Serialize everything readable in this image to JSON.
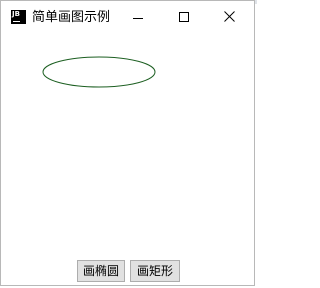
{
  "window": {
    "title": "简单画图示例",
    "icon_label": "JB",
    "icon_name": "java-app-icon",
    "controls": {
      "minimize_icon": "minimize-icon",
      "maximize_icon": "maximize-icon",
      "close_icon": "close-icon"
    }
  },
  "canvas": {
    "shape": "ellipse",
    "stroke_color": "#1b5e20",
    "background": "#ffffff"
  },
  "buttons": {
    "draw_ellipse_label": "画椭圆",
    "draw_rect_label": "画矩形"
  },
  "colors": {
    "window_bg": "#ffffff",
    "button_bg": "#e1e1e1",
    "button_border": "#adadad"
  }
}
